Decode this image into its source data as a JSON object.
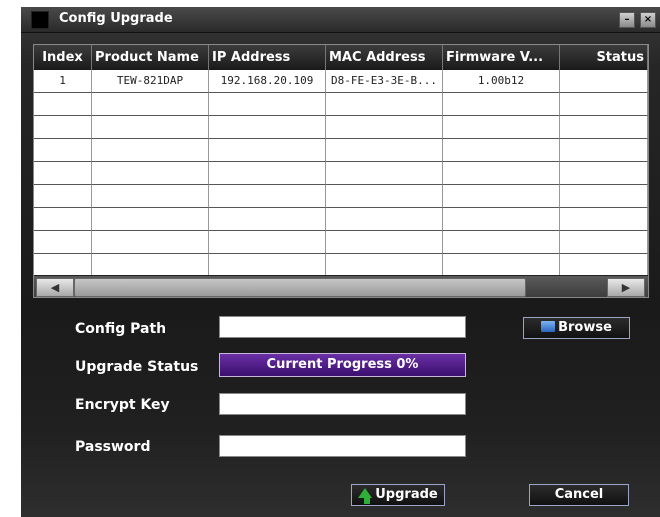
{
  "window": {
    "title": "Config Upgrade",
    "minimize_label": "–",
    "close_label": "×"
  },
  "table": {
    "columns": [
      "Index",
      "Product Name",
      "IP Address",
      "MAC Address",
      "Firmware V...",
      "Status"
    ],
    "rows": [
      [
        "1",
        "TEW-821DAP",
        "192.168.20.109",
        "D8-FE-E3-3E-B...",
        "1.00b12",
        ""
      ],
      [
        "",
        "",
        "",
        "",
        "",
        ""
      ],
      [
        "",
        "",
        "",
        "",
        "",
        ""
      ],
      [
        "",
        "",
        "",
        "",
        "",
        ""
      ],
      [
        "",
        "",
        "",
        "",
        "",
        ""
      ],
      [
        "",
        "",
        "",
        "",
        "",
        ""
      ],
      [
        "",
        "",
        "",
        "",
        "",
        ""
      ],
      [
        "",
        "",
        "",
        "",
        "",
        ""
      ],
      [
        "",
        "",
        "",
        "",
        "",
        ""
      ]
    ]
  },
  "scrollbar": {
    "left_arrow": "◀",
    "right_arrow": "▶"
  },
  "form": {
    "config_path_label": "Config Path",
    "config_path_value": "",
    "browse_label": "Browse",
    "upgrade_status_label": "Upgrade Status",
    "progress_text": "Current Progress 0%",
    "progress_fraction": 0,
    "encrypt_key_label": "Encrypt Key",
    "encrypt_key_value": "",
    "password_label": "Password",
    "password_value": ""
  },
  "buttons": {
    "upgrade_label": "Upgrade",
    "cancel_label": "Cancel"
  },
  "colors": {
    "progress_bar": "#4a1a86",
    "window_bg": "#1f1f1f",
    "button_border": "#9aa3c8"
  }
}
